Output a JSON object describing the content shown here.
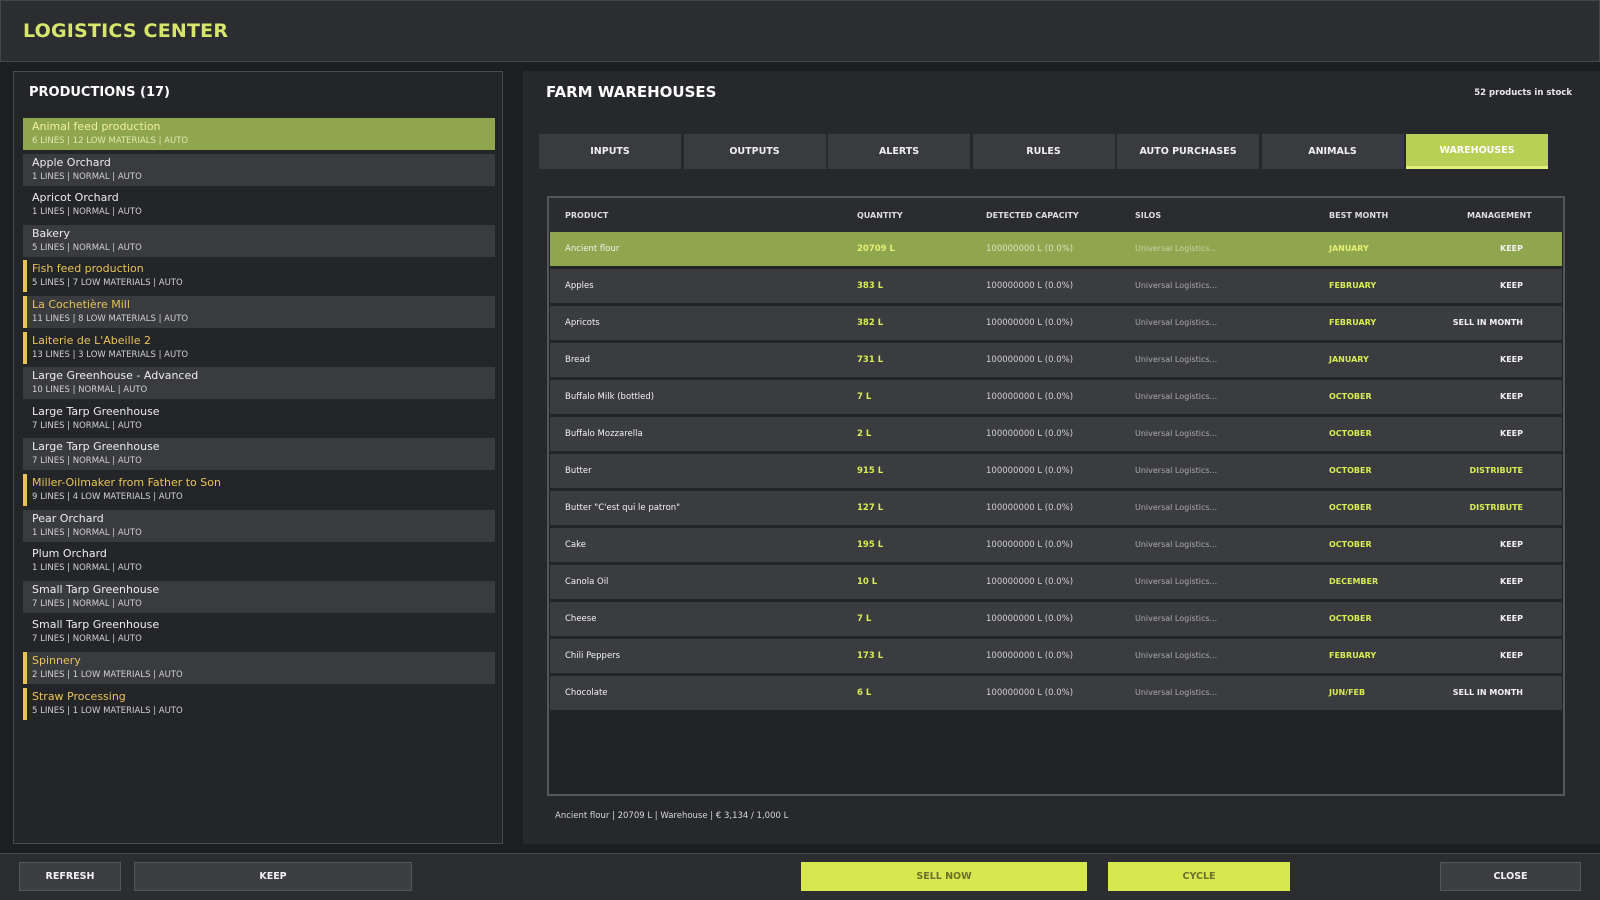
{
  "app": {
    "title": "LOGISTICS CENTER"
  },
  "productions": {
    "title": "PRODUCTIONS (17)",
    "items": [
      {
        "name": "Animal feed production",
        "sub": "6 LINES | 12 LOW MATERIALS | AUTO",
        "state": "selected"
      },
      {
        "name": "Apple Orchard",
        "sub": "1 LINES | NORMAL | AUTO",
        "state": "normal"
      },
      {
        "name": "Apricot Orchard",
        "sub": "1 LINES | NORMAL | AUTO",
        "state": "normal"
      },
      {
        "name": "Bakery",
        "sub": "5 LINES | NORMAL | AUTO",
        "state": "normal"
      },
      {
        "name": "Fish feed production",
        "sub": "5 LINES | 7 LOW MATERIALS | AUTO",
        "state": "warning"
      },
      {
        "name": "La Cochetière Mill",
        "sub": "11 LINES | 8 LOW MATERIALS | AUTO",
        "state": "warning"
      },
      {
        "name": "Laiterie de L'Abeille 2",
        "sub": "13 LINES | 3 LOW MATERIALS | AUTO",
        "state": "warning"
      },
      {
        "name": "Large Greenhouse - Advanced",
        "sub": "10 LINES | NORMAL | AUTO",
        "state": "normal"
      },
      {
        "name": "Large Tarp Greenhouse",
        "sub": "7 LINES | NORMAL | AUTO",
        "state": "normal"
      },
      {
        "name": "Large Tarp Greenhouse",
        "sub": "7 LINES | NORMAL | AUTO",
        "state": "normal"
      },
      {
        "name": "Miller-Oilmaker from Father to Son",
        "sub": "9 LINES | 4 LOW MATERIALS | AUTO",
        "state": "warning"
      },
      {
        "name": "Pear Orchard",
        "sub": "1 LINES | NORMAL | AUTO",
        "state": "normal"
      },
      {
        "name": "Plum Orchard",
        "sub": "1 LINES | NORMAL | AUTO",
        "state": "normal"
      },
      {
        "name": "Small Tarp Greenhouse",
        "sub": "7 LINES | NORMAL | AUTO",
        "state": "normal"
      },
      {
        "name": "Small Tarp Greenhouse",
        "sub": "7 LINES | NORMAL | AUTO",
        "state": "normal"
      },
      {
        "name": "Spinnery",
        "sub": "2 LINES | 1 LOW MATERIALS | AUTO",
        "state": "warning"
      },
      {
        "name": "Straw Processing",
        "sub": "5 LINES | 1 LOW MATERIALS | AUTO",
        "state": "warning"
      }
    ]
  },
  "warehouses": {
    "title": "FARM WAREHOUSES",
    "stock_count": "52 products in stock",
    "tabs": [
      {
        "label": "INPUTS",
        "active": false
      },
      {
        "label": "OUTPUTS",
        "active": false
      },
      {
        "label": "ALERTS",
        "active": false
      },
      {
        "label": "RULES",
        "active": false
      },
      {
        "label": "AUTO PURCHASES",
        "active": false
      },
      {
        "label": "ANIMALS",
        "active": false
      },
      {
        "label": "WAREHOUSES",
        "active": true
      }
    ],
    "columns": {
      "product": "PRODUCT",
      "quantity": "QUANTITY",
      "capacity": "DETECTED CAPACITY",
      "silos": "SILOS",
      "best_month": "BEST MONTH",
      "management": "MANAGEMENT"
    },
    "rows": [
      {
        "product": "Ancient flour",
        "quantity": "20709 L",
        "capacity": "100000000 L (0.0%)",
        "silos": "Universal Logistics...",
        "best_month": "JANUARY",
        "management": "KEEP",
        "selected": true
      },
      {
        "product": "Apples",
        "quantity": "383 L",
        "capacity": "100000000 L (0.0%)",
        "silos": "Universal Logistics...",
        "best_month": "FEBRUARY",
        "management": "KEEP"
      },
      {
        "product": "Apricots",
        "quantity": "382 L",
        "capacity": "100000000 L (0.0%)",
        "silos": "Universal Logistics...",
        "best_month": "FEBRUARY",
        "management": "SELL IN MONTH"
      },
      {
        "product": "Bread",
        "quantity": "731 L",
        "capacity": "100000000 L (0.0%)",
        "silos": "Universal Logistics...",
        "best_month": "JANUARY",
        "management": "KEEP"
      },
      {
        "product": "Buffalo Milk (bottled)",
        "quantity": "7 L",
        "capacity": "100000000 L (0.0%)",
        "silos": "Universal Logistics...",
        "best_month": "OCTOBER",
        "management": "KEEP"
      },
      {
        "product": "Buffalo Mozzarella",
        "quantity": "2 L",
        "capacity": "100000000 L (0.0%)",
        "silos": "Universal Logistics...",
        "best_month": "OCTOBER",
        "management": "KEEP"
      },
      {
        "product": "Butter",
        "quantity": "915 L",
        "capacity": "100000000 L (0.0%)",
        "silos": "Universal Logistics...",
        "best_month": "OCTOBER",
        "management": "DISTRIBUTE"
      },
      {
        "product": "Butter \"C'est qui le patron\"",
        "quantity": "127 L",
        "capacity": "100000000 L (0.0%)",
        "silos": "Universal Logistics...",
        "best_month": "OCTOBER",
        "management": "DISTRIBUTE"
      },
      {
        "product": "Cake",
        "quantity": "195 L",
        "capacity": "100000000 L (0.0%)",
        "silos": "Universal Logistics...",
        "best_month": "OCTOBER",
        "management": "KEEP"
      },
      {
        "product": "Canola Oil",
        "quantity": "10 L",
        "capacity": "100000000 L (0.0%)",
        "silos": "Universal Logistics...",
        "best_month": "DECEMBER",
        "management": "KEEP"
      },
      {
        "product": "Cheese",
        "quantity": "7 L",
        "capacity": "100000000 L (0.0%)",
        "silos": "Universal Logistics...",
        "best_month": "OCTOBER",
        "management": "KEEP"
      },
      {
        "product": "Chili Peppers",
        "quantity": "173 L",
        "capacity": "100000000 L (0.0%)",
        "silos": "Universal Logistics...",
        "best_month": "FEBRUARY",
        "management": "KEEP"
      },
      {
        "product": "Chocolate",
        "quantity": "6 L",
        "capacity": "100000000 L (0.0%)",
        "silos": "Universal Logistics...",
        "best_month": "JUN/FEB",
        "management": "SELL IN MONTH"
      }
    ],
    "status_line": "Ancient flour | 20709 L | Warehouse | € 3,134 / 1,000 L"
  },
  "footer": {
    "refresh": "REFRESH",
    "keep": "KEEP",
    "sell_now": "SELL NOW",
    "cycle": "CYCLE",
    "close": "CLOSE"
  },
  "colors": {
    "accent": "#d6e84e",
    "selected_row": "#8fa54e",
    "warning": "#e8c456",
    "background": "#1d1e21"
  }
}
